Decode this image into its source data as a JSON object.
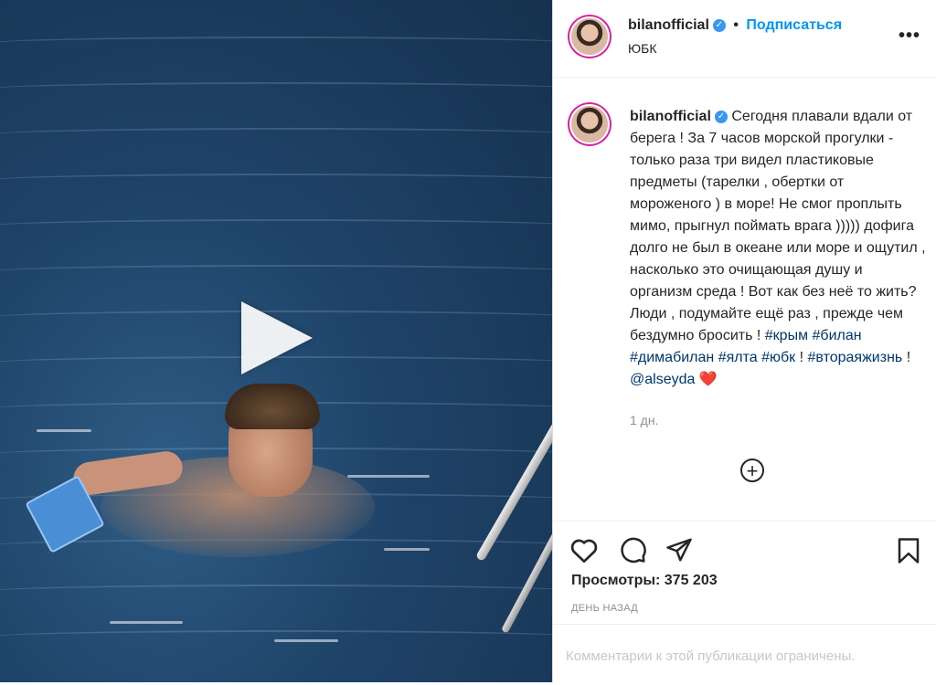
{
  "header": {
    "username": "bilanofficial",
    "separator": "•",
    "follow_label": "Подписаться",
    "location": "ЮБК",
    "more_icon": "more-horizontal-icon"
  },
  "caption": {
    "username": "bilanofficial",
    "text": "Сегодня плавали вдали от берега ! За 7 часов морской прогулки - только раза три видел пластиковые предметы (тарелки , обертки от мороженого ) в море! Не смог проплыть мимо, прыгнул поймать врага ))))) дофига долго не был в океане или море и ощутил , насколько это очищающая душу и организм среда ! Вот как без неё то жить? Люди , подумайте ещё раз , прежде чем бездумно бросить !",
    "hashtags": [
      "#крым",
      "#билан",
      "#димабилан",
      "#ялта",
      "#юбк"
    ],
    "bang1": "!",
    "hashtag2": "#втораяжизнь",
    "bang2": "!",
    "mention": "@alseyda",
    "emoji": "❤️",
    "time": "1 дн."
  },
  "actions": {
    "views_label": "Просмотры: 375 203",
    "posted": "День назад",
    "comments_disabled": "Комментарии к этой публикации ограничены."
  },
  "media": {
    "type": "video",
    "play_icon": "play-icon"
  },
  "icons": [
    "like-icon",
    "comment-icon",
    "share-icon",
    "save-icon",
    "add-icon"
  ],
  "colors": {
    "link": "#00376b",
    "follow": "#0095f6",
    "secondary": "#8e8e8e"
  }
}
